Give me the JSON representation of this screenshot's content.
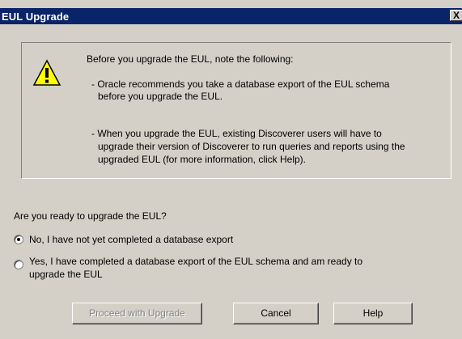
{
  "window": {
    "title": "EUL Upgrade",
    "close_glyph": "X"
  },
  "info": {
    "intro": "Before you upgrade the EUL, note the following:",
    "note1_line1": "- Oracle recommends you take a database export of the EUL schema",
    "note1_line2": "before you upgrade the EUL.",
    "note2_line1": "- When you upgrade the EUL, existing Discoverer users will have to",
    "note2_line2": "upgrade their version of Discoverer to run queries and reports using the",
    "note2_line3": "upgraded EUL (for more information, click Help)."
  },
  "question": "Are you ready to upgrade the EUL?",
  "options": [
    {
      "label": "No, I have not yet completed a database export",
      "selected": true
    },
    {
      "label_line1": "Yes, I have completed a database export of the EUL schema and am ready to",
      "label_line2": "upgrade the EUL",
      "selected": false
    }
  ],
  "buttons": {
    "proceed": "Proceed with Upgrade",
    "cancel": "Cancel",
    "help": "Help"
  },
  "colors": {
    "titlebar": "#0a246a",
    "face": "#d4d0c8",
    "warning": "#ffff00"
  },
  "icons": {
    "warning": "warning-triangle-icon"
  }
}
